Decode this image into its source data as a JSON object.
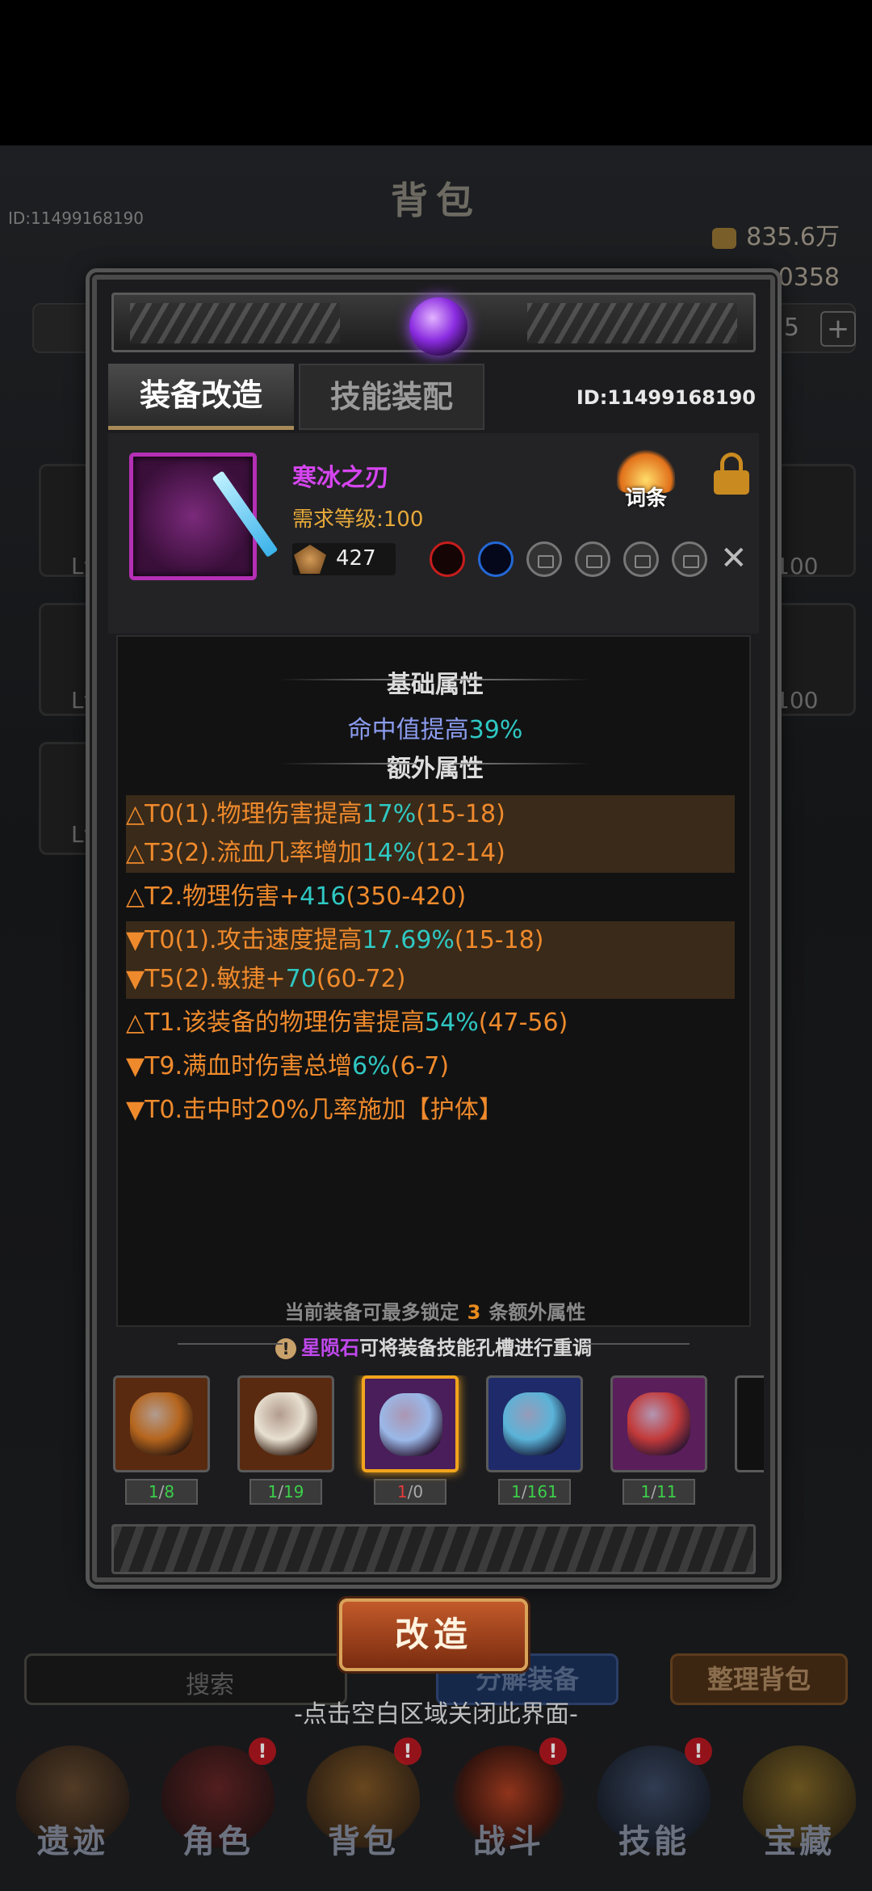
{
  "background": {
    "title": "背包",
    "player_id": "ID:11499168190",
    "gold": "835.6万",
    "gems": "0358",
    "count_suffix": "5",
    "plus": "+",
    "slot_levels": [
      "Lv",
      "Lv",
      "Lv",
      "100",
      "100"
    ],
    "search_label": "搜索",
    "decompose_label": "分解装备",
    "sort_label": "整理背包",
    "close_hint": "-点击空白区域关闭此界面-"
  },
  "bottom_nav": [
    {
      "label": "遗迹",
      "badge": ""
    },
    {
      "label": "角色",
      "badge": "!"
    },
    {
      "label": "背包",
      "badge": "!"
    },
    {
      "label": "战斗",
      "badge": "!"
    },
    {
      "label": "技能",
      "badge": "!"
    },
    {
      "label": "宝藏",
      "badge": ""
    }
  ],
  "modal": {
    "tabs": {
      "reforge": "装备改造",
      "skill": "技能装配"
    },
    "id": "ID:11499168190",
    "item": {
      "name": "寒冰之刃",
      "level_req": "需求等级:100",
      "power": "427",
      "entries_label": "词条"
    },
    "basic_title": "基础属性",
    "basic_attr": {
      "pre": "命中值提高",
      "value": "39%"
    },
    "extra_title": "额外属性",
    "affixes": [
      {
        "pre": "△T0(1).物理伤害提高",
        "hl": "17%",
        "post": "(15-18)"
      },
      {
        "pre": "△T3(2).流血几率增加",
        "hl": "14%",
        "post": "(12-14)"
      },
      {
        "pre": "△T2.物理伤害+",
        "hl": "416",
        "post": "(350-420)"
      },
      {
        "pre": "▼T0(1).攻击速度提高",
        "hl": "17.69%",
        "post": "(15-18)"
      },
      {
        "pre": "▼T5(2).敏捷+",
        "hl": "70",
        "post": "(60-72)"
      },
      {
        "pre": "△T1.该装备的物理伤害提高",
        "hl": "54%",
        "post": "(47-56)"
      },
      {
        "pre": "▼T9.满血时伤害总增",
        "hl": "6%",
        "post": "(6-7)"
      },
      {
        "pre": "▼T0.击中时20%几率施加【护体】",
        "hl": "",
        "post": ""
      }
    ],
    "lock_note": {
      "pre": "当前装备可最多锁定",
      "num": "3",
      "post": "条额外属性"
    },
    "stone_hint": {
      "icon": "!",
      "stone": "星陨石",
      "rest": "可将装备技能孔槽进行重调"
    },
    "stones": [
      {
        "have": "1",
        "sep": "/",
        "need": "8",
        "ok": true,
        "color": "#b5651d",
        "bg": "#5a2a10"
      },
      {
        "have": "1",
        "sep": "/",
        "need": "19",
        "ok": true,
        "color": "#e8e0d0",
        "bg": "#5a2a10"
      },
      {
        "have": "1",
        "sep": "/",
        "need": "0",
        "ok": false,
        "color": "#9ab8e8",
        "bg": "#4a1e5a"
      },
      {
        "have": "1",
        "sep": "/",
        "need": "161",
        "ok": true,
        "color": "#5ab3d8",
        "bg": "#1e2a6a"
      },
      {
        "have": "1",
        "sep": "/",
        "need": "11",
        "ok": true,
        "color": "#c23a3a",
        "bg": "#5a1e5a"
      }
    ],
    "reforge_button": "改造"
  },
  "colors": {
    "accent_orange": "#ef8a2c",
    "accent_cyan": "#2fc8c3",
    "item_purple": "#d545ef"
  }
}
